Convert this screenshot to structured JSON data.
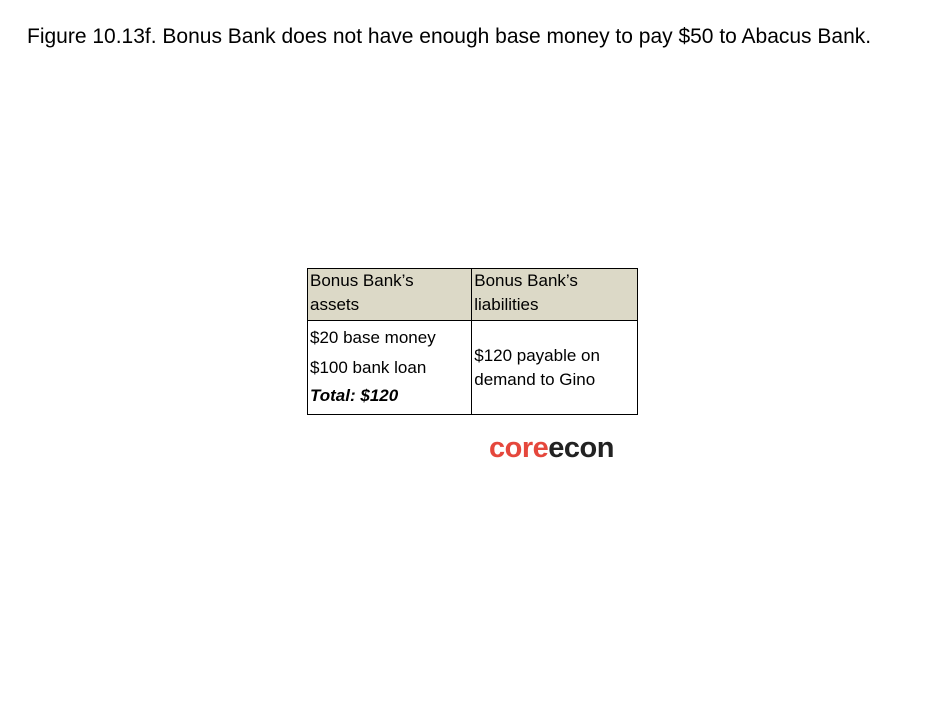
{
  "caption": "Figure 10.13f. Bonus Bank does not have enough base money to pay $50 to Abacus Bank.",
  "table": {
    "headers": {
      "assets": [
        "Bonus Bank’s",
        "assets"
      ],
      "liabilities": [
        "Bonus Bank’s",
        "liabilities"
      ]
    },
    "assets": [
      "$20 base money",
      "$100 bank loan"
    ],
    "assets_total": "Total: $120",
    "liabilities": [
      "$120 payable on",
      "demand to Gino"
    ],
    "header_color": "#dcd9c7"
  },
  "logo": {
    "part1": "core",
    "part2": "econ",
    "colors": {
      "core": "#e5473c",
      "econ": "#222222"
    }
  }
}
